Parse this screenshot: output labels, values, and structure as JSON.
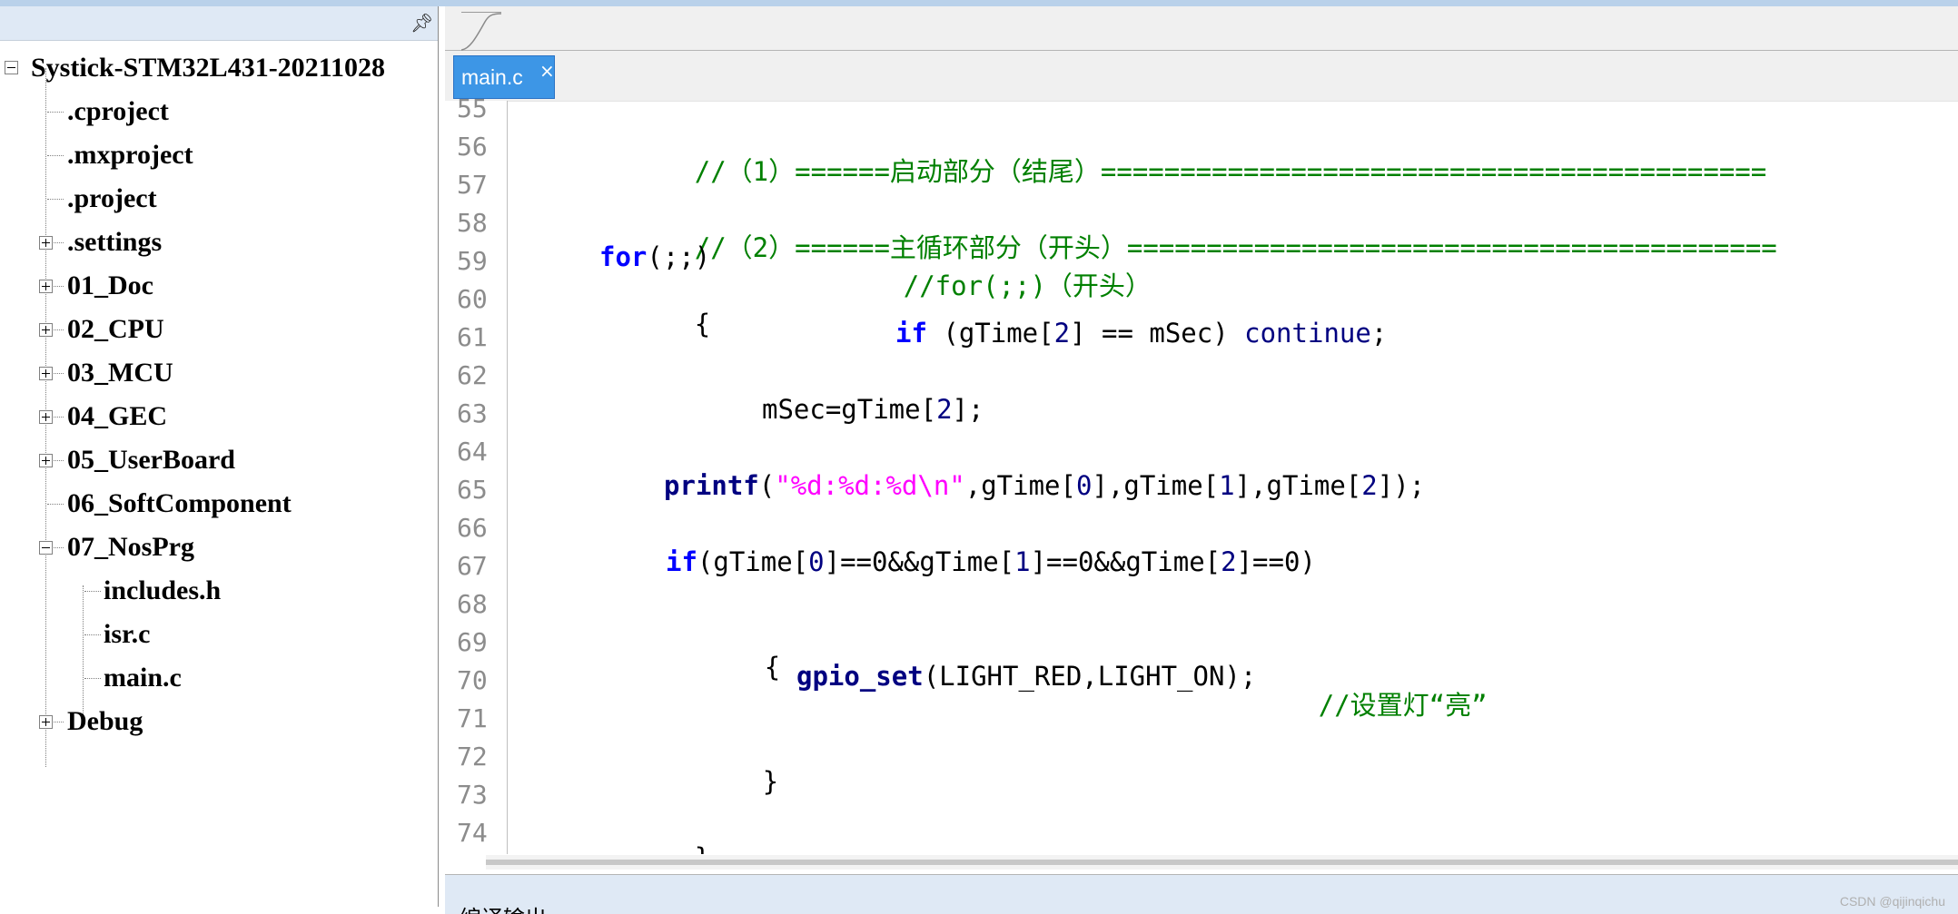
{
  "project_tree": {
    "root": "Systick-STM32L431-20211028",
    "items": [
      {
        "label": ".cproject",
        "expandable": false
      },
      {
        "label": ".mxproject",
        "expandable": false
      },
      {
        "label": ".project",
        "expandable": false
      },
      {
        "label": ".settings",
        "expandable": true
      },
      {
        "label": "01_Doc",
        "expandable": true
      },
      {
        "label": "02_CPU",
        "expandable": true
      },
      {
        "label": "03_MCU",
        "expandable": true
      },
      {
        "label": "04_GEC",
        "expandable": true
      },
      {
        "label": "05_UserBoard",
        "expandable": true
      },
      {
        "label": "06_SoftComponent",
        "expandable": false
      },
      {
        "label": "07_NosPrg",
        "expandable": true,
        "expanded": true
      },
      {
        "label": "includes.h",
        "expandable": false
      },
      {
        "label": "isr.c",
        "expandable": false
      },
      {
        "label": "main.c",
        "expandable": false
      },
      {
        "label": "Debug",
        "expandable": true
      }
    ]
  },
  "editor": {
    "tab_label": "main.c",
    "tab_close": "×",
    "line_numbers": [
      "55",
      "56",
      "57",
      "58",
      "59",
      "60",
      "61",
      "62",
      "63",
      "64",
      "65",
      "66",
      "67",
      "68",
      "69",
      "70",
      "71",
      "72",
      "73",
      "74"
    ],
    "code": {
      "l56": "//（1）======启动部分（结尾）==========================================",
      "l58": "//（2）======主循环部分（开头）=========================================",
      "l59_kw": "for",
      "l59_rest": "(;;)",
      "l59_cm": "//for(;;)（开头）",
      "l60": "{",
      "l61_kw": "if",
      "l61_a": " (gTime[",
      "l61_n": "2",
      "l61_b": "] == mSec) ",
      "l61_kw2": "continue",
      "l61_c": ";",
      "l63_a": "mSec=gTime[",
      "l63_n": "2",
      "l63_b": "];",
      "l65_fn": "printf",
      "l65_a": "(",
      "l65_str": "\"%d:%d:%d\\n\"",
      "l65_b": ",gTime[",
      "l65_n1": "0",
      "l65_c": "],gTime[",
      "l65_n2": "1",
      "l65_d": "],gTime[",
      "l65_n3": "2",
      "l65_e": "]);",
      "l67_kw": "if",
      "l67_a": "(gTime[",
      "l67_n1": "0",
      "l67_b": "]==0&&gTime[",
      "l67_n2": "1",
      "l67_c": "]==0&&gTime[",
      "l67_n3": "2",
      "l67_d": "]==0)",
      "l69": "{",
      "l70_fn": "gpio_set",
      "l70_a": "(LIGHT_RED,LIGHT_ON);",
      "l70_cm": "//设置灯“亮”",
      "l72": "}",
      "l74": "}"
    }
  },
  "bottom_panel": {
    "label": "编译输出"
  },
  "watermark": "CSDN @qijinqichu",
  "colors": {
    "comment": "#008000",
    "keyword": "#0000ff",
    "function": "#000080",
    "string": "#ff00ff",
    "tab_active": "#3d96e6"
  }
}
